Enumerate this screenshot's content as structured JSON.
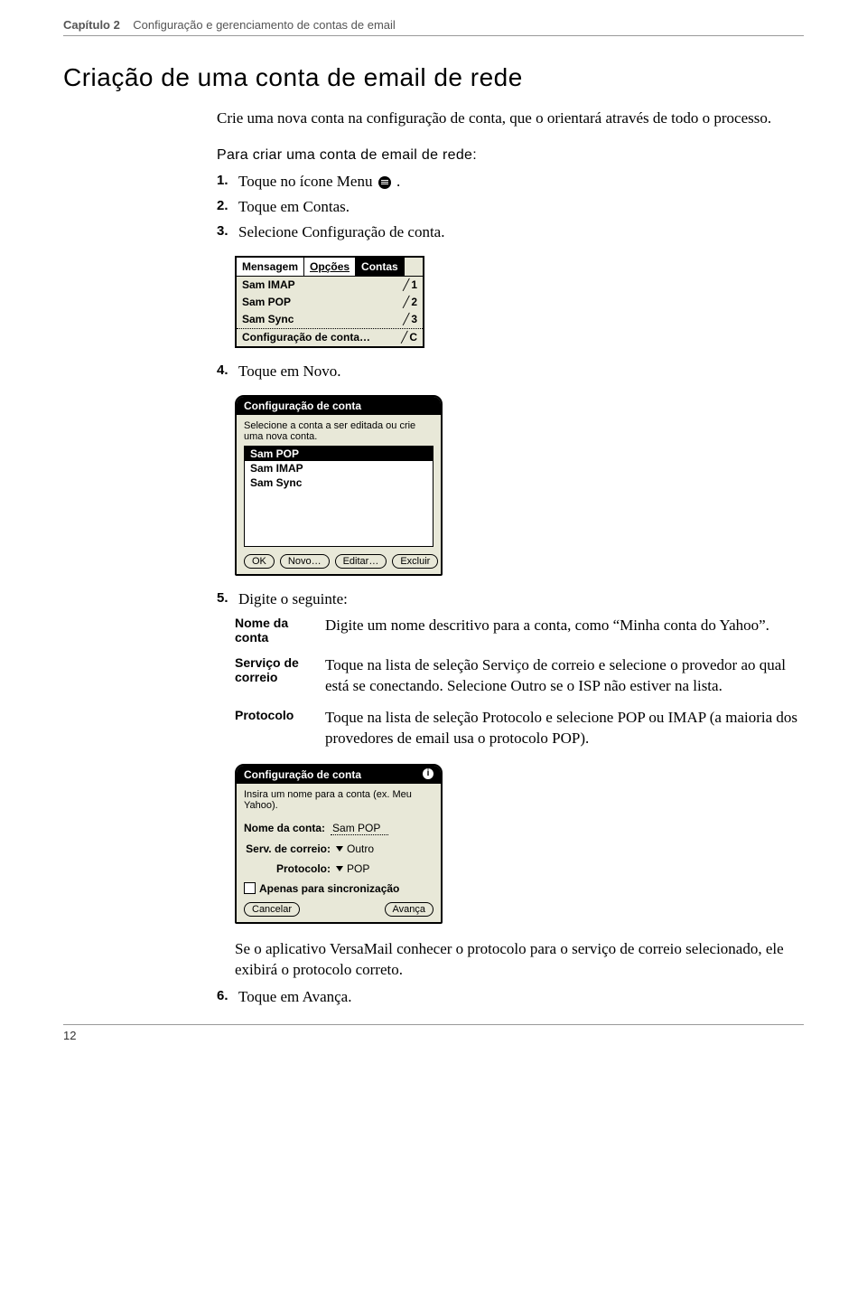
{
  "header": {
    "chapter": "Capítulo 2",
    "title": "Configuração e gerenciamento de contas de email"
  },
  "section_title": "Criação de uma conta de email de rede",
  "intro": "Crie uma nova conta na configuração de conta, que o orientará através de todo o processo.",
  "subhead": "Para criar uma conta de email de rede:",
  "steps": {
    "s1_a": "Toque no ícone Menu ",
    "s1_b": ".",
    "s2": "Toque em Contas.",
    "s3": "Selecione Configuração de conta.",
    "s4": "Toque em Novo.",
    "s5": "Digite o seguinte:",
    "s6": "Toque em Avança."
  },
  "menu_screenshot": {
    "tab1": "Mensagem",
    "tab2": "Opções",
    "tab3": "Contas",
    "item1": "Sam IMAP",
    "sc1": "1",
    "item2": "Sam POP",
    "sc2": "2",
    "item3": "Sam Sync",
    "sc3": "3",
    "item4": "Configuração de conta…",
    "sc4": "C"
  },
  "config_screenshot": {
    "title": "Configuração de conta",
    "instruction": "Selecione a conta a ser editada ou crie uma nova conta.",
    "opt1": "Sam POP",
    "opt2": "Sam IMAP",
    "opt3": "Sam Sync",
    "btn_ok": "OK",
    "btn_novo": "Novo…",
    "btn_editar": "Editar…",
    "btn_excluir": "Excluir"
  },
  "definitions": {
    "d1_label": "Nome da conta",
    "d1_text": "Digite um nome descritivo para a conta, como “Minha conta do Yahoo”.",
    "d2_label": "Serviço de correio",
    "d2_text": "Toque na lista de seleção Serviço de correio e selecione o provedor ao qual está se conectando. Selecione Outro se o ISP não estiver na lista.",
    "d3_label": "Protocolo",
    "d3_text": "Toque na lista de seleção Protocolo e selecione POP ou IMAP (a maioria dos provedores de email usa o protocolo POP)."
  },
  "form_screenshot": {
    "title": "Configuração de conta",
    "instruction": "Insira um nome para a conta (ex. Meu Yahoo).",
    "name_label": "Nome da conta:",
    "name_value": "Sam POP",
    "serv_label": "Serv. de correio:",
    "serv_value": "Outro",
    "proto_label": "Protocolo:",
    "proto_value": "POP",
    "sync_label": "Apenas para sincronização",
    "btn_cancel": "Cancelar",
    "btn_next": "Avança"
  },
  "closing": "Se o aplicativo VersaMail conhecer o protocolo para o serviço de correio selecionado, ele exibirá o protocolo correto.",
  "page_number": "12"
}
